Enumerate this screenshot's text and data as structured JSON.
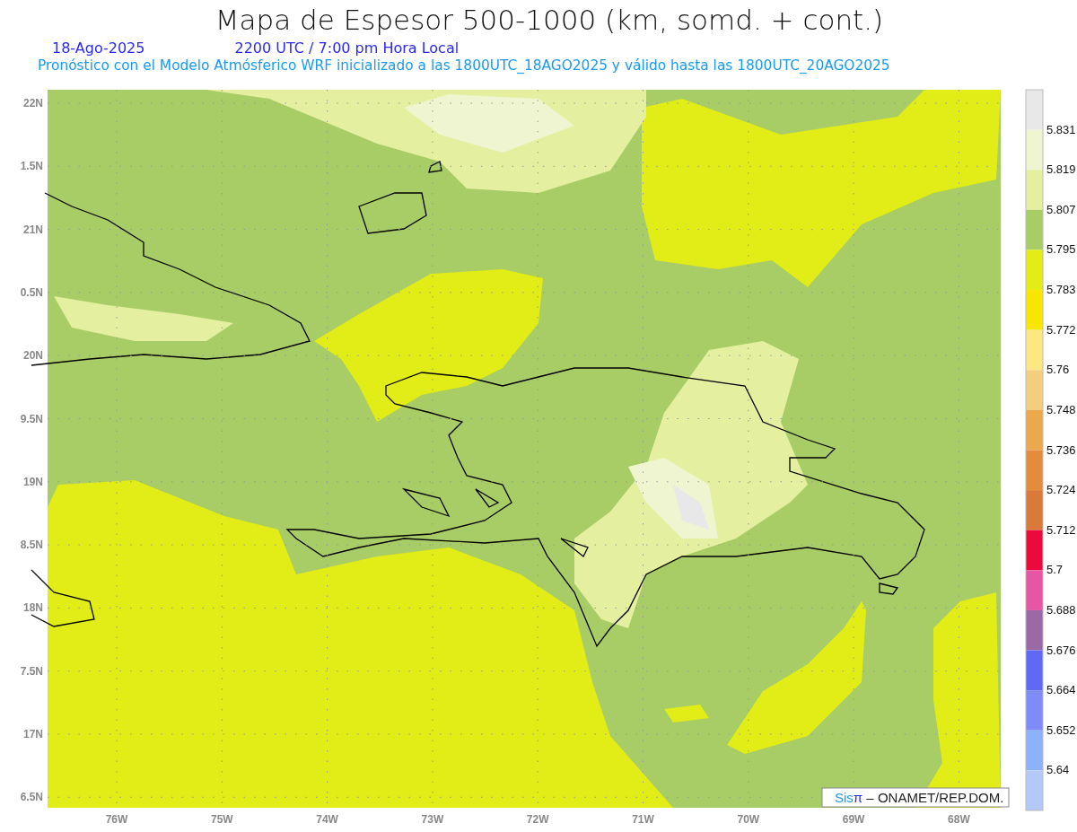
{
  "title": "Mapa de Espesor 500-1000 (km, somd. + cont.)",
  "date": "18-Ago-2025",
  "time": "2200 UTC / 7:00 pm Hora Local",
  "forecast_note": "Pronóstico con el Modelo Atmósferico WRF inicializado a las 1800UTC_18AGO2025 y válido hasta las  1800UTC_20AGO2025",
  "map": {
    "lat_labels": [
      "22N",
      "1.5N",
      "21N",
      "0.5N",
      "20N",
      "9.5N",
      "19N",
      "8.5N",
      "18N",
      "7.5N",
      "17N",
      "6.5N"
    ],
    "lon_labels": [
      "76W",
      "75W",
      "74W",
      "73W",
      "72W",
      "71W",
      "70W",
      "69W",
      "68W"
    ],
    "credit": {
      "brand_prefix": "Sis",
      "brand_symbol": "π",
      "text": "– ONAMET/REP.DOM."
    }
  },
  "legend": {
    "swatches": [
      {
        "color": "#e8e8e8"
      },
      {
        "color": "#eef5d0"
      },
      {
        "color": "#e4f0a0"
      },
      {
        "color": "#a8cc66"
      },
      {
        "color": "#e2ec16"
      },
      {
        "color": "#f9e600"
      },
      {
        "color": "#fbe883"
      },
      {
        "color": "#f2ce7e"
      },
      {
        "color": "#eca84c"
      },
      {
        "color": "#e58c3c"
      },
      {
        "color": "#da7a3a"
      },
      {
        "color": "#ec0a3c"
      },
      {
        "color": "#e656a2"
      },
      {
        "color": "#9a6aa6"
      },
      {
        "color": "#6268f6"
      },
      {
        "color": "#7e8cfa"
      },
      {
        "color": "#8cb2fa"
      },
      {
        "color": "#b4c8fa"
      }
    ],
    "labels": [
      "5.831",
      "5.819",
      "5.807",
      "5.795",
      "5.783",
      "5.772",
      "5.76",
      "5.748",
      "5.736",
      "5.724",
      "5.712",
      "5.7",
      "5.688",
      "5.676",
      "5.664",
      "5.652",
      "5.64"
    ]
  }
}
